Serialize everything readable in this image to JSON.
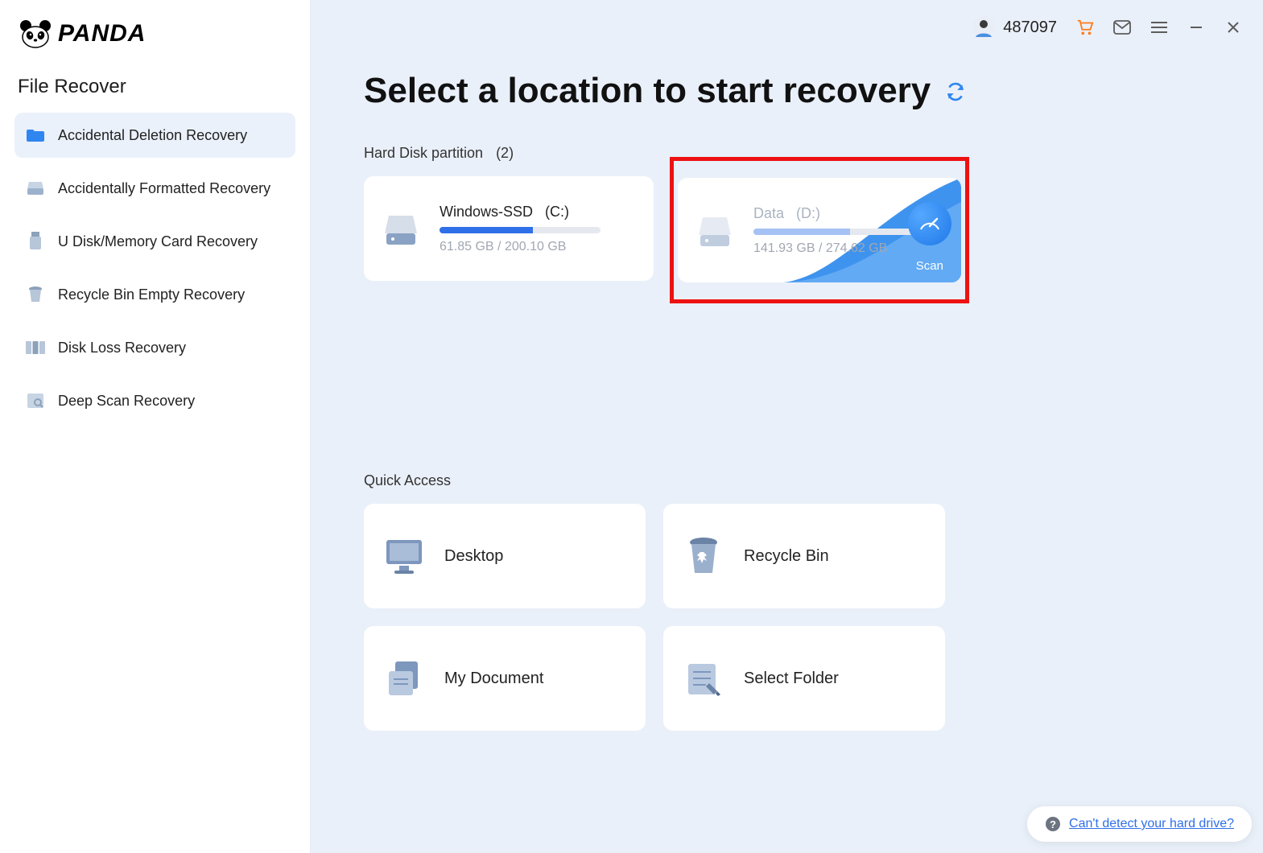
{
  "brand": "PANDA",
  "sidebar": {
    "section_title": "File Recover",
    "items": [
      {
        "label": "Accidental Deletion Recovery",
        "icon": "folder"
      },
      {
        "label": "Accidentally Formatted Recovery",
        "icon": "drive"
      },
      {
        "label": "U Disk/Memory Card Recovery",
        "icon": "usb"
      },
      {
        "label": "Recycle Bin Empty Recovery",
        "icon": "trash"
      },
      {
        "label": "Disk Loss Recovery",
        "icon": "partition"
      },
      {
        "label": "Deep Scan Recovery",
        "icon": "scan"
      }
    ]
  },
  "topbar": {
    "user_id": "487097"
  },
  "page": {
    "title": "Select a location to start recovery",
    "hdd_section_label": "Hard Disk partition",
    "hdd_count": "(2)",
    "partitions": [
      {
        "name": "Windows-SSD",
        "letter": "(C:)",
        "used": "61.85 GB",
        "total": "200.10 GB",
        "fill_pct": 58
      },
      {
        "name": "Data",
        "letter": "(D:)",
        "used": "141.93 GB",
        "total": "274.62 GB",
        "fill_pct": 60
      }
    ],
    "scan_label": "Scan",
    "quick_access_title": "Quick Access",
    "quick_access": [
      {
        "label": "Desktop",
        "icon": "monitor"
      },
      {
        "label": "Recycle Bin",
        "icon": "trash-big"
      },
      {
        "label": "My Document",
        "icon": "docs"
      },
      {
        "label": "Select Folder",
        "icon": "folder-edit"
      }
    ],
    "help_link": "Can't detect your hard drive?"
  }
}
